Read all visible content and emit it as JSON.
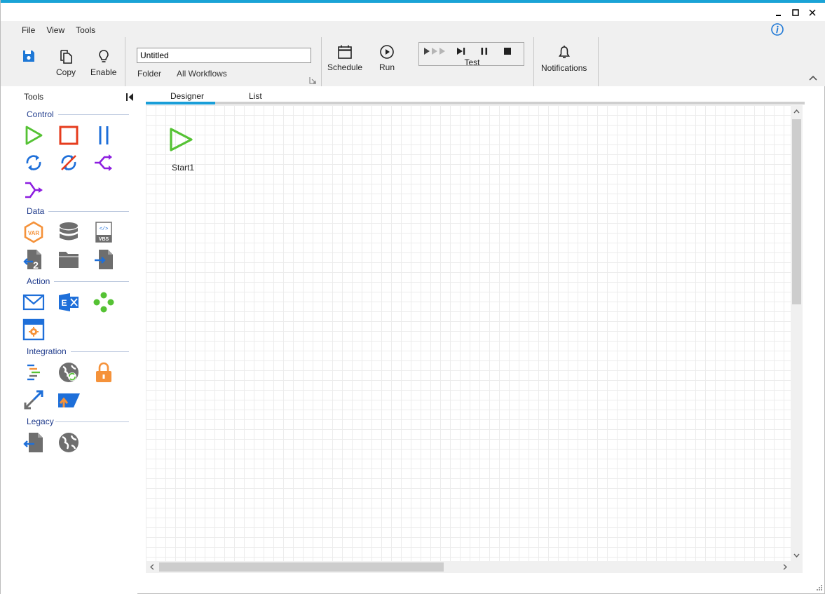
{
  "window": {
    "minimize_label": "Minimize",
    "maximize_label": "Maximize",
    "close_label": "Close"
  },
  "menu": {
    "items": [
      {
        "label": "File"
      },
      {
        "label": "View"
      },
      {
        "label": "Tools"
      }
    ]
  },
  "ribbon": {
    "save_label": "Save",
    "copy_label": "Copy",
    "enable_label": "Enable",
    "workflow_name": "Untitled",
    "folder_label": "Folder",
    "all_workflows_label": "All Workflows",
    "schedule_label": "Schedule",
    "run_label": "Run",
    "test_label": "Test",
    "notifications_label": "Notifications"
  },
  "toolbox": {
    "title": "Tools",
    "categories": {
      "control": "Control",
      "data": "Data",
      "action": "Action",
      "integration": "Integration",
      "legacy": "Legacy"
    }
  },
  "designer": {
    "tabs": [
      {
        "label": "Designer",
        "active": true
      },
      {
        "label": "List",
        "active": false
      }
    ],
    "nodes": [
      {
        "label": "Start1",
        "icon": "start-play-icon"
      }
    ]
  },
  "colors": {
    "accent": "#1aa3d6",
    "tab_active": "#1a9ed8",
    "green": "#55c234",
    "red": "#e63c1e",
    "blue": "#1e6fd9",
    "purple": "#8d1ee0",
    "orange": "#f5923a",
    "gray": "#6e6e6e",
    "category_text": "#1f3b8c"
  }
}
